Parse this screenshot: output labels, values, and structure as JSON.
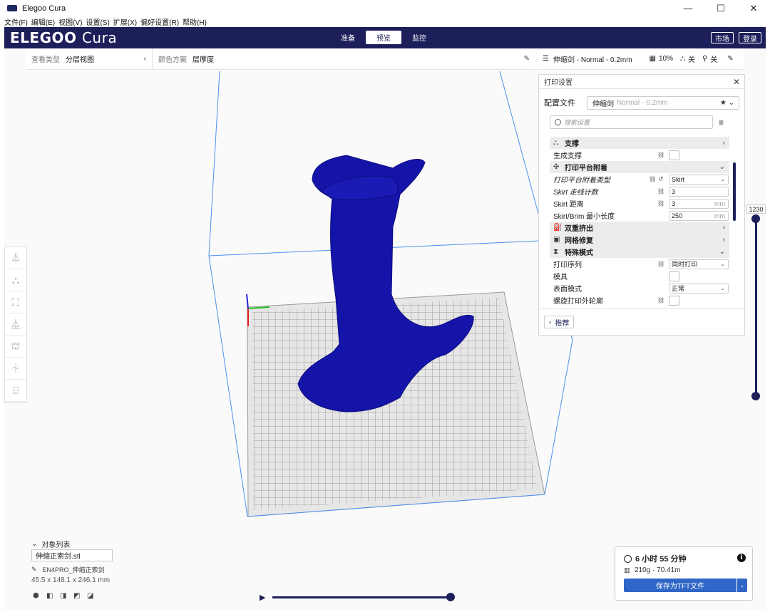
{
  "window": {
    "title": "Elegoo Cura",
    "minimize": "—",
    "maximize": "☐",
    "close": "✕"
  },
  "menu": [
    "文件(F)",
    "编辑(E)",
    "视图(V)",
    "设置(S)",
    "扩展(X)",
    "偏好设置(R)",
    "帮助(H)"
  ],
  "header": {
    "logo_main": "ELEGOO",
    "logo_sub": "Cura",
    "stages": [
      "准备",
      "预览",
      "监控"
    ],
    "active_stage": "预览",
    "marketplace": "市场",
    "login": "登录"
  },
  "viewbar": {
    "view_type_label": "查看类型",
    "view_type_value": "分层视图",
    "color_scheme_label": "颜色方案",
    "color_scheme_value": "层厚度"
  },
  "print_summary": {
    "profile": "伸缩剑 - Normal - 0.2mm",
    "infill": "10%",
    "support": "关",
    "adhesion": "关"
  },
  "panel": {
    "title": "打印设置",
    "profile_label": "配置文件",
    "profile_name": "伸缩剑",
    "profile_sub": "Normal - 0.2mm",
    "search_placeholder": "搜索设置",
    "recommend": "推荐",
    "categories": {
      "support": "支撑",
      "adhesion": "打印平台附着",
      "dual": "双重挤出",
      "mesh": "网格修复",
      "special": "特殊模式"
    },
    "rows": {
      "gen_support": "生成支撑",
      "adhesion_type": "打印平台附着类型",
      "adhesion_type_value": "Skirt",
      "skirt_lines": "Skirt 走线计数",
      "skirt_lines_value": "3",
      "skirt_dist": "Skirt 距离",
      "skirt_dist_value": "3",
      "skirt_min": "Skirt/Brim 最小长度",
      "skirt_min_value": "250",
      "unit_mm": "mm",
      "sequence": "打印序列",
      "sequence_value": "同时打印",
      "mold": "模具",
      "surface": "表面模式",
      "surface_value": "正常",
      "spiral": "螺旋打印外轮廓"
    }
  },
  "layer_slider": {
    "value": "1230"
  },
  "objects": {
    "title": "对象列表",
    "name": "伸缩正索剑.stl",
    "machine": "EN4PRO_伸缩正索剑",
    "dims": "45.5 x 148.1 x 246.1 mm"
  },
  "output": {
    "time": "6 小时 55 分钟",
    "material": "210g · 70.41m",
    "save": "保存为TFT文件",
    "info": "i"
  },
  "colors": {
    "accent": "#1d1f5a",
    "model": "#1414a8",
    "save_button": "#2f66c7"
  }
}
